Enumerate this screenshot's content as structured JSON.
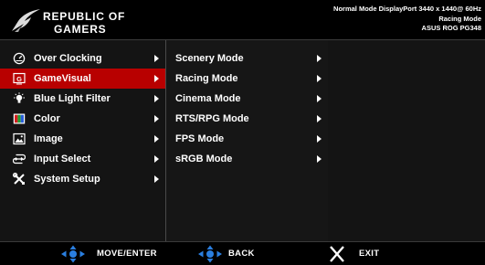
{
  "header": {
    "brand_line_1": "REPUBLIC OF",
    "brand_line_2": "GAMERS",
    "logo_icon": "rog-eye-logo-icon",
    "status_line_1": "Normal Mode DisplayPort 3440 x 1440@ 60Hz",
    "status_line_2": "Racing Mode",
    "status_line_3": "ASUS ROG PG348"
  },
  "main_menu": [
    {
      "label": "Over Clocking",
      "icon": "speedometer-icon",
      "selected": false
    },
    {
      "label": "GameVisual",
      "icon": "gamevisual-icon",
      "selected": true
    },
    {
      "label": "Blue Light Filter",
      "icon": "lightbulb-icon",
      "selected": false
    },
    {
      "label": "Color",
      "icon": "color-palette-icon",
      "selected": false
    },
    {
      "label": "Image",
      "icon": "image-icon",
      "selected": false
    },
    {
      "label": "Input Select",
      "icon": "input-select-icon",
      "selected": false
    },
    {
      "label": "System Setup",
      "icon": "tools-icon",
      "selected": false
    }
  ],
  "sub_menu": [
    {
      "label": "Scenery Mode"
    },
    {
      "label": "Racing Mode"
    },
    {
      "label": "Cinema Mode"
    },
    {
      "label": "RTS/RPG Mode"
    },
    {
      "label": "FPS Mode"
    },
    {
      "label": "sRGB Mode"
    }
  ],
  "footer": {
    "move_label": "MOVE/ENTER",
    "back_label": "BACK",
    "exit_label": "EXIT",
    "move_icon": "navigation-joystick-icon",
    "back_icon": "joystick-back-icon",
    "exit_icon": "close-x-icon"
  },
  "colors": {
    "selection": "#b80000",
    "background": "#141414",
    "joystick_blue": "#2a7fe0",
    "text": "#ffffff"
  }
}
